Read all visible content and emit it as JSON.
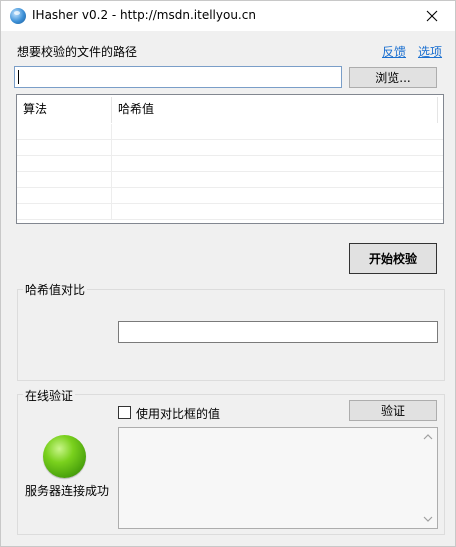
{
  "window": {
    "title": "IHasher v0.2 - http://msdn.itellyou.cn"
  },
  "file_section": {
    "path_label": "想要校验的文件的路径",
    "feedback_link": "反馈",
    "options_link": "选项",
    "path_value": "",
    "browse_button": "浏览..."
  },
  "hash_list": {
    "columns": [
      "算法",
      "哈希值"
    ],
    "rows": []
  },
  "start_button": "开始校验",
  "compare_group": {
    "title": "哈希值对比",
    "input_value": ""
  },
  "online_group": {
    "title": "在线验证",
    "use_compare_label": "使用对比框的值",
    "use_compare_checked": false,
    "verify_button": "验证",
    "status_text": "服务器连接成功",
    "status_color": "#5cb514"
  }
}
